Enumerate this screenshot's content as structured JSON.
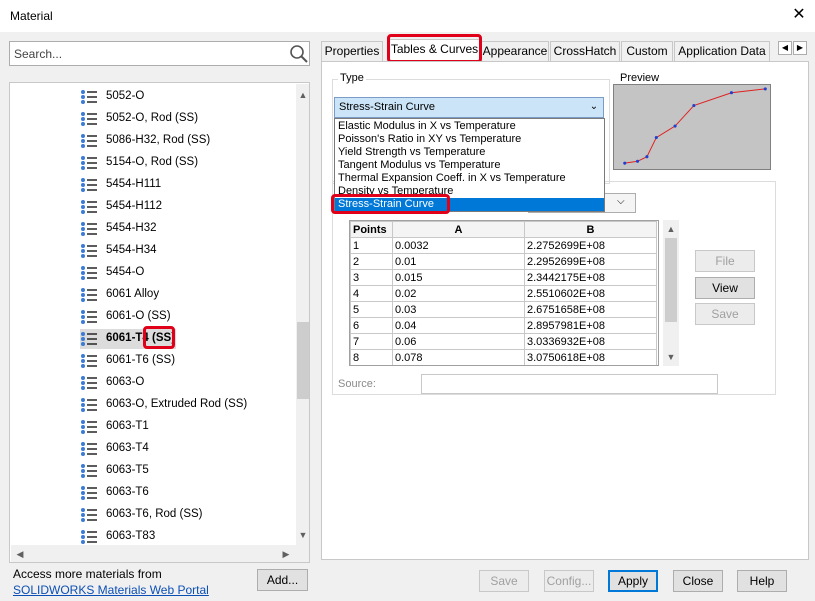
{
  "window": {
    "title": "Material",
    "close_glyph": "✕"
  },
  "search": {
    "placeholder": "Search..."
  },
  "tree": {
    "items": [
      {
        "label": "5052-O"
      },
      {
        "label": "5052-O, Rod (SS)"
      },
      {
        "label": "5086-H32, Rod (SS)"
      },
      {
        "label": "5154-O, Rod (SS)"
      },
      {
        "label": "5454-H111"
      },
      {
        "label": "5454-H112"
      },
      {
        "label": "5454-H32"
      },
      {
        "label": "5454-H34"
      },
      {
        "label": "5454-O"
      },
      {
        "label": "6061 Alloy"
      },
      {
        "label": "6061-O (SS)"
      },
      {
        "label": "6061-T4 (SS)",
        "selected": true
      },
      {
        "label": "6061-T6 (SS)"
      },
      {
        "label": "6063-O"
      },
      {
        "label": "6063-O, Extruded Rod (SS)"
      },
      {
        "label": "6063-T1"
      },
      {
        "label": "6063-T4"
      },
      {
        "label": "6063-T5"
      },
      {
        "label": "6063-T6"
      },
      {
        "label": "6063-T6, Rod (SS)"
      },
      {
        "label": "6063-T83"
      }
    ]
  },
  "footer": {
    "access_text": "Access more materials from",
    "portal_link": "SOLIDWORKS Materials Web Portal",
    "add_button": "Add..."
  },
  "tabs": [
    {
      "label": "Properties"
    },
    {
      "label": "Tables & Curves",
      "active": true
    },
    {
      "label": "Appearance"
    },
    {
      "label": "CrossHatch"
    },
    {
      "label": "Custom"
    },
    {
      "label": "Application Data"
    }
  ],
  "type_group": {
    "label": "Type",
    "selected": "Stress-Strain Curve",
    "options": [
      "Elastic Modulus in X vs Temperature",
      "Poisson's Ratio in XY vs Temperature",
      "Yield Strength vs Temperature",
      "Tangent Modulus vs Temperature",
      "Thermal Expansion Coeff. in X vs Temperature",
      "Density vs Temperature",
      "Stress-Strain Curve"
    ]
  },
  "preview": {
    "label": "Preview",
    "points": [
      [
        0.0032,
        227526990.0
      ],
      [
        0.01,
        229526990.0
      ],
      [
        0.015,
        234421750.0
      ],
      [
        0.02,
        255106020.0
      ],
      [
        0.03,
        267516580.0
      ],
      [
        0.04,
        289579810.0
      ],
      [
        0.06,
        303369320.0
      ],
      [
        0.078,
        307506180.0
      ]
    ]
  },
  "table": {
    "headers": [
      "Points",
      "A",
      "B"
    ],
    "rows": [
      [
        "1",
        "0.0032",
        "2.2752699E+08"
      ],
      [
        "2",
        "0.01",
        "2.2952699E+08"
      ],
      [
        "3",
        "0.015",
        "2.3442175E+08"
      ],
      [
        "4",
        "0.02",
        "2.5510602E+08"
      ],
      [
        "5",
        "0.03",
        "2.6751658E+08"
      ],
      [
        "6",
        "0.04",
        "2.8957981E+08"
      ],
      [
        "7",
        "0.06",
        "3.0336932E+08"
      ],
      [
        "8",
        "0.078",
        "3.0750618E+08"
      ]
    ]
  },
  "side_buttons": {
    "file": "File",
    "view": "View",
    "save": "Save"
  },
  "source": {
    "label": "Source:"
  },
  "bottom_buttons": {
    "save": "Save",
    "config": "Config...",
    "apply": "Apply",
    "close": "Close",
    "help": "Help"
  },
  "colors": {
    "highlight": "#e0001a",
    "selection": "#0078d7",
    "curve": "#e02020",
    "curve_points": "#2040d0"
  }
}
